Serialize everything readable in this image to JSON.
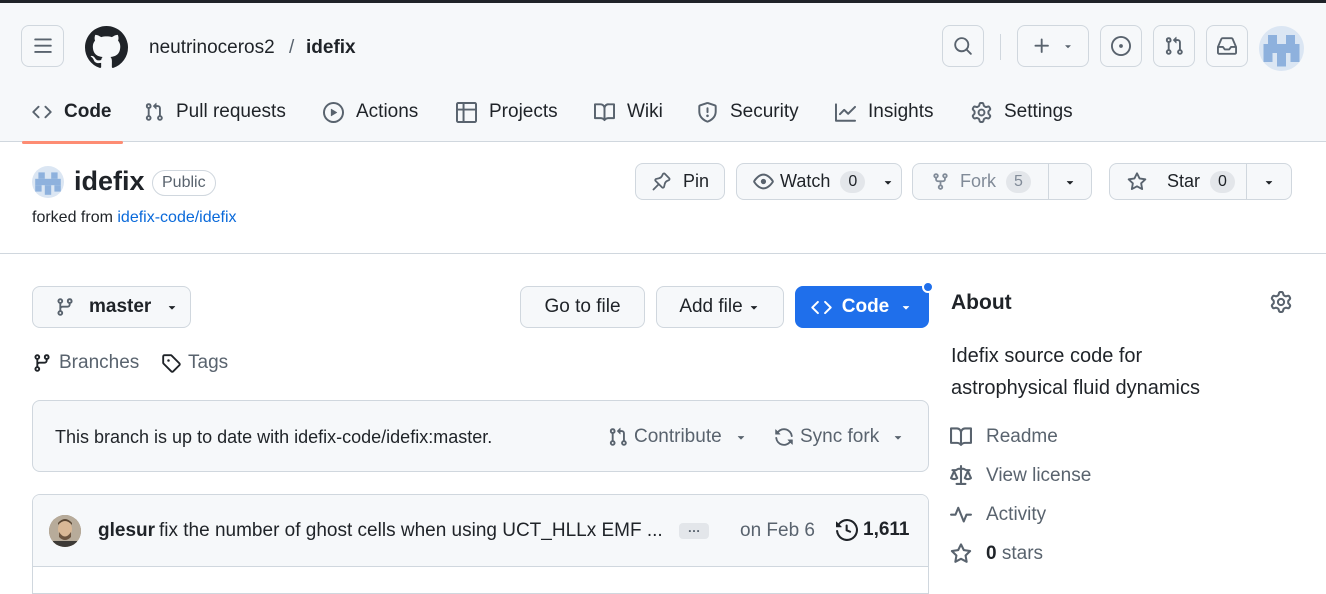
{
  "header": {
    "owner": "neutrinoceros2",
    "separator": "/",
    "repo": "idefix"
  },
  "tabs": [
    {
      "label": "Code",
      "icon": "code-icon"
    },
    {
      "label": "Pull requests",
      "icon": "git-pull-request-icon"
    },
    {
      "label": "Actions",
      "icon": "play-icon"
    },
    {
      "label": "Projects",
      "icon": "table-icon"
    },
    {
      "label": "Wiki",
      "icon": "book-icon"
    },
    {
      "label": "Security",
      "icon": "shield-icon"
    },
    {
      "label": "Insights",
      "icon": "graph-icon"
    },
    {
      "label": "Settings",
      "icon": "gear-icon"
    }
  ],
  "repo": {
    "name": "idefix",
    "visibility": "Public",
    "forked_prefix": "forked from ",
    "forked_from": "idefix-code/idefix",
    "pin_label": "Pin",
    "watch_label": "Watch",
    "watch_count": "0",
    "fork_label": "Fork",
    "fork_count": "5",
    "star_label": "Star",
    "star_count": "0"
  },
  "toolbar": {
    "branch": "master",
    "go_to_file": "Go to file",
    "add_file": "Add file",
    "code": "Code",
    "branches": "Branches",
    "tags": "Tags"
  },
  "sync_box": {
    "message": "This branch is up to date with idefix-code/idefix:master.",
    "contribute": "Contribute",
    "sync_fork": "Sync fork"
  },
  "commit": {
    "author": "glesur",
    "message": "fix the number of ghost cells when using UCT_HLLx EMF ...",
    "ellipsis": "…",
    "date": "on Feb 6",
    "count": "1,611"
  },
  "about": {
    "title": "About",
    "description": "Idefix source code for astrophysical fluid dynamics",
    "readme": "Readme",
    "license": "View license",
    "activity": "Activity",
    "stars_count": "0",
    "stars_label": " stars"
  },
  "colors": {
    "accent": "#fd8c73",
    "primary": "#1f6feb",
    "link": "#0969da"
  }
}
